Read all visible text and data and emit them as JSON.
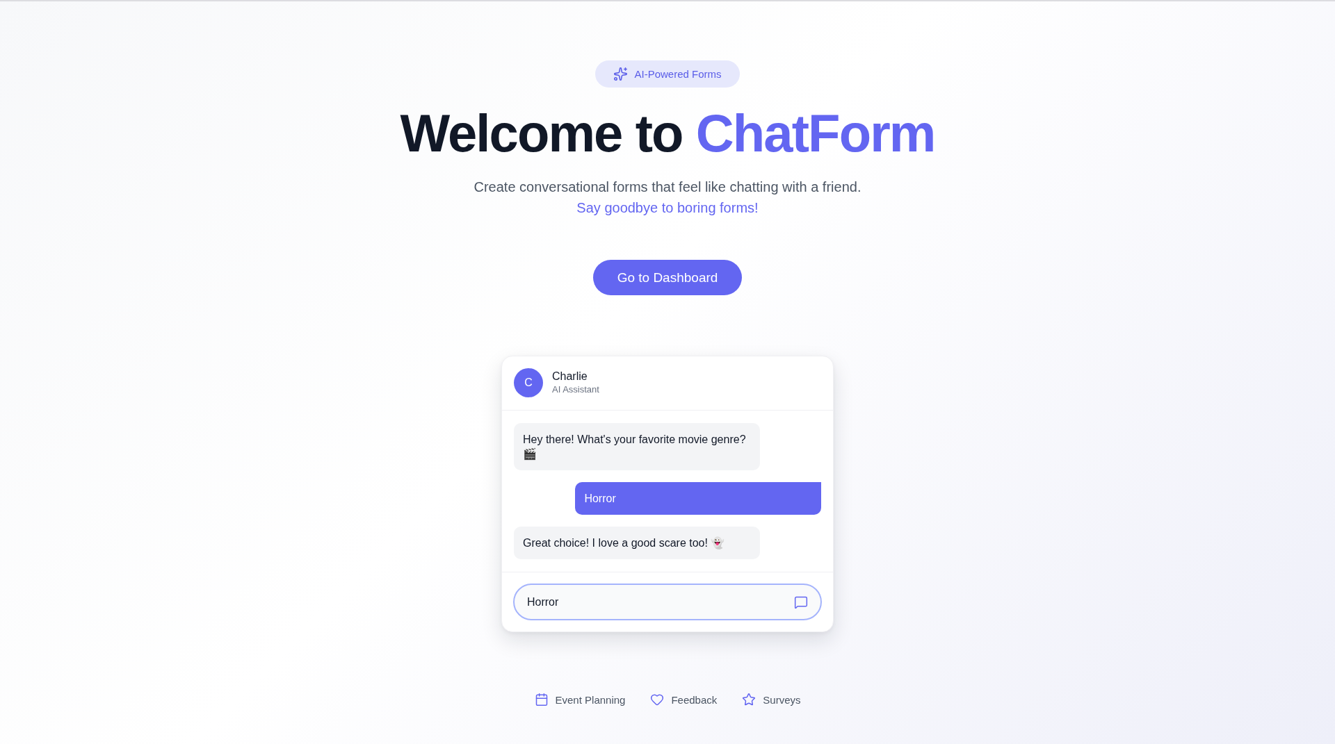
{
  "badge": {
    "label": "AI-Powered Forms"
  },
  "hero": {
    "title_lead": "Welcome to",
    "title_highlight": "ChatForm",
    "subtitle": "Create conversational forms that feel like chatting with a friend.",
    "tagline": "Say goodbye to boring forms!"
  },
  "cta_button": {
    "label": "Go to Dashboard"
  },
  "chat_preview": {
    "assistant": {
      "initial": "C",
      "name": "Charlie",
      "role": "AI Assistant"
    },
    "messages": [
      {
        "kind": "bot",
        "text": "Hey there! What's your favorite movie genre? 🎬"
      },
      {
        "kind": "user",
        "text": "Horror"
      },
      {
        "kind": "bot",
        "text": "Great choice! I love a good scare too! 👻"
      }
    ],
    "input": {
      "value": "Horror"
    }
  },
  "features": [
    {
      "label": "Event Planning"
    },
    {
      "label": "Feedback"
    },
    {
      "label": "Surveys"
    }
  ]
}
